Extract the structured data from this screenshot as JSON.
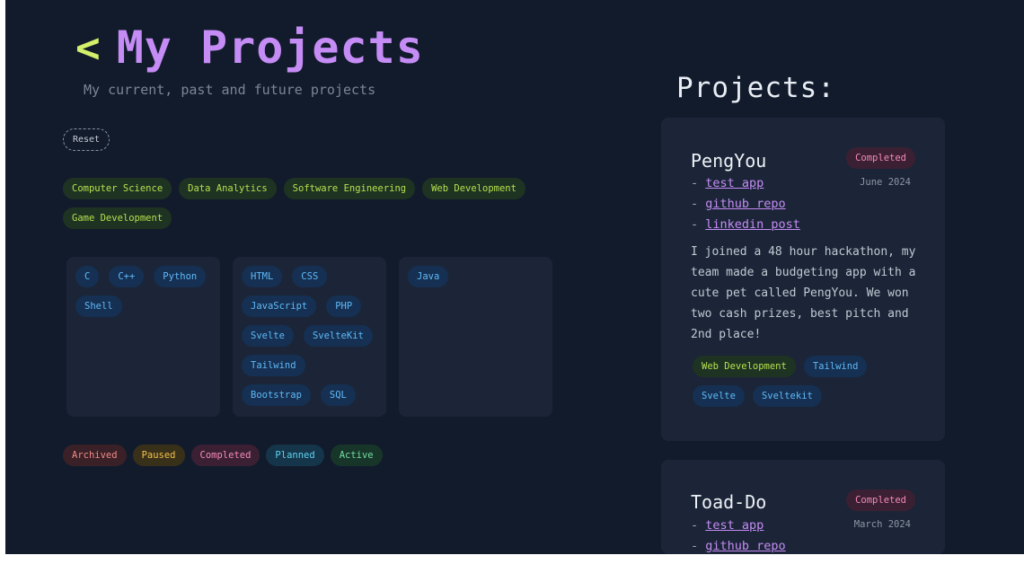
{
  "header": {
    "back_label": "<",
    "title": "My Projects",
    "subtitle": "My current, past and future projects"
  },
  "filters": {
    "reset_label": "Reset",
    "categories": [
      "Computer Science",
      "Data Analytics",
      "Software Engineering",
      "Web Development",
      "Game Development"
    ],
    "language_groups": [
      [
        "C",
        "C++",
        "Python",
        "Shell"
      ],
      [
        "HTML",
        "CSS",
        "JavaScript",
        "PHP",
        "Svelte",
        "SvelteKit",
        "Tailwind",
        "Bootstrap",
        "SQL"
      ],
      [
        "Java"
      ]
    ],
    "statuses": [
      "Archived",
      "Paused",
      "Completed",
      "Planned",
      "Active"
    ]
  },
  "sidebar": {
    "heading": "Projects:",
    "projects": [
      {
        "name": "PengYou",
        "status": "Completed",
        "date": "June 2024",
        "links": [
          "test app",
          "github repo",
          "linkedin post"
        ],
        "description": "I joined a 48 hour hackathon, my team made a budgeting app with a cute pet called PengYou. We won two cash prizes, best pitch and 2nd place!",
        "tags": [
          {
            "label": "Web Development",
            "kind": "category"
          },
          {
            "label": "Tailwind",
            "kind": "language"
          },
          {
            "label": "Svelte",
            "kind": "language"
          },
          {
            "label": "Sveltekit",
            "kind": "language"
          }
        ]
      },
      {
        "name": "Toad-Do",
        "status": "Completed",
        "date": "March 2024",
        "links": [
          "test app",
          "github repo"
        ]
      }
    ]
  },
  "colors": {
    "background": "#121b2c",
    "panel": "#1b2537",
    "accent_purple": "#c58cf5",
    "accent_lime": "#d4f06a"
  }
}
